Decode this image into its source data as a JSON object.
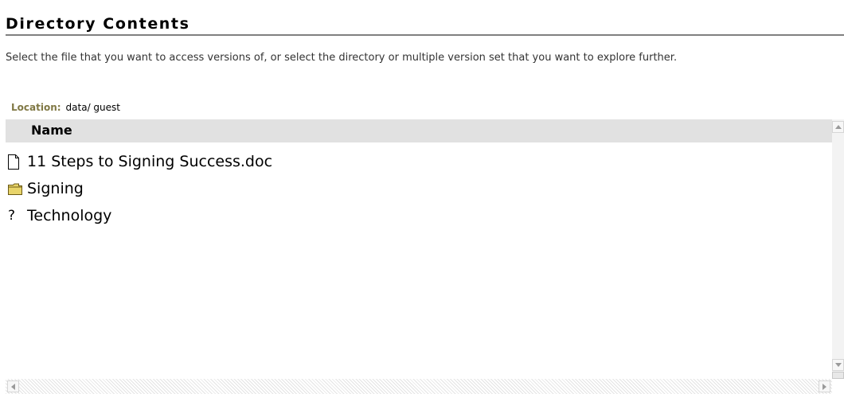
{
  "page": {
    "title": "Directory Contents",
    "description": "Select the file that you want to access versions of, or select the directory or multiple version set that you want to explore further."
  },
  "location": {
    "label": "Location:",
    "value": "data/ guest"
  },
  "table": {
    "header": "Name",
    "rows": [
      {
        "icon": "document-icon",
        "label": "11 Steps to Signing Success.doc"
      },
      {
        "icon": "folder-icon",
        "label": "Signing"
      },
      {
        "icon": "unknown-icon",
        "glyph": "?",
        "label": "Technology"
      }
    ]
  },
  "colors": {
    "location_label": "#807844",
    "header_bg": "#e1e1e1",
    "folder_fill": "#e8d46a",
    "title_rule": "#808080"
  },
  "icons": {
    "scroll_up": "arrow-up-icon",
    "scroll_down": "arrow-down-icon",
    "scroll_left": "arrow-left-icon",
    "scroll_right": "arrow-right-icon"
  }
}
